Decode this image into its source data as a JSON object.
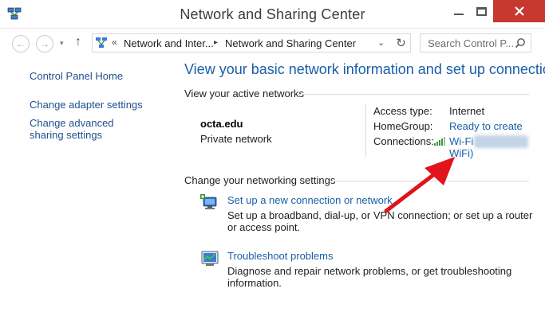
{
  "window": {
    "title": "Network and Sharing Center"
  },
  "address": {
    "crumbs": [
      "Network and Inter...",
      "Network and Sharing Center"
    ],
    "chevrons": [
      "«",
      "▸",
      "▸"
    ],
    "search_placeholder": "Search Control P..."
  },
  "sidebar": {
    "items": [
      {
        "label": "Control Panel Home"
      },
      {
        "label": "Change adapter settings"
      },
      {
        "label": "Change advanced sharing settings"
      }
    ]
  },
  "main": {
    "title": "View your basic network information and set up connections",
    "active_networks_label": "View your active networks",
    "network": {
      "name": "octa.edu",
      "category": "Private network"
    },
    "properties": {
      "access_type_label": "Access type:",
      "access_type_value": "Internet",
      "homegroup_label": "HomeGroup:",
      "homegroup_value": "Ready to create",
      "connections_label": "Connections:",
      "connections_value_line1": "Wi-Fi (",
      "connections_value_line2": "WiFi)"
    },
    "change_settings_label": "Change your networking settings",
    "tasks": [
      {
        "link": "Set up a new connection or network",
        "desc": "Set up a broadband, dial-up, or VPN connection; or set up a router or access point.",
        "icon": "new-connection-icon"
      },
      {
        "link": "Troubleshoot problems",
        "desc": "Diagnose and repair network problems, or get troubleshooting information.",
        "icon": "troubleshoot-icon"
      }
    ]
  },
  "colors": {
    "link": "#1a5fa8",
    "close_button": "#c7382e",
    "annotation_arrow": "#e0141a"
  }
}
